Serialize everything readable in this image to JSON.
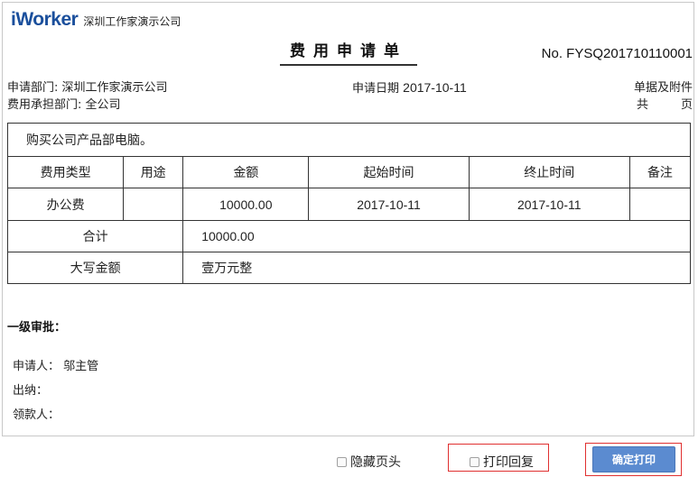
{
  "header": {
    "logo_text": "iWorker",
    "company": "深圳工作家演示公司",
    "title": "费用申请单",
    "doc_no": "No. FYSQ201710110001"
  },
  "meta": {
    "dept_label": "申请部门:",
    "dept_value": "深圳工作家演示公司",
    "bearer_label": "费用承担部门:",
    "bearer_value": "全公司",
    "date_label": "申请日期",
    "date_value": "2017-10-11",
    "attach_label": "单据及附件",
    "pages_prefix": "共",
    "pages_suffix": "页"
  },
  "table": {
    "description": "购买公司产品部电脑。",
    "headers": [
      "费用类型",
      "用途",
      "金额",
      "起始时间",
      "终止时间",
      "备注"
    ],
    "rows": [
      {
        "type": "办公费",
        "purpose": "",
        "amount": "10000.00",
        "start": "2017-10-11",
        "end": "2017-10-11",
        "note": ""
      }
    ],
    "total_label": "合计",
    "total_value": "10000.00",
    "capital_label": "大写金额",
    "capital_value": "壹万元整"
  },
  "approval": {
    "title": "一级审批：",
    "applicant_label": "申请人：",
    "applicant_value": "邬主管",
    "cashier_label": "出纳：",
    "payee_label": "领款人："
  },
  "footer": {
    "hide_header_label": "隐藏页头",
    "print_reply_label": "打印回复",
    "confirm_print_label": "确定打印"
  }
}
